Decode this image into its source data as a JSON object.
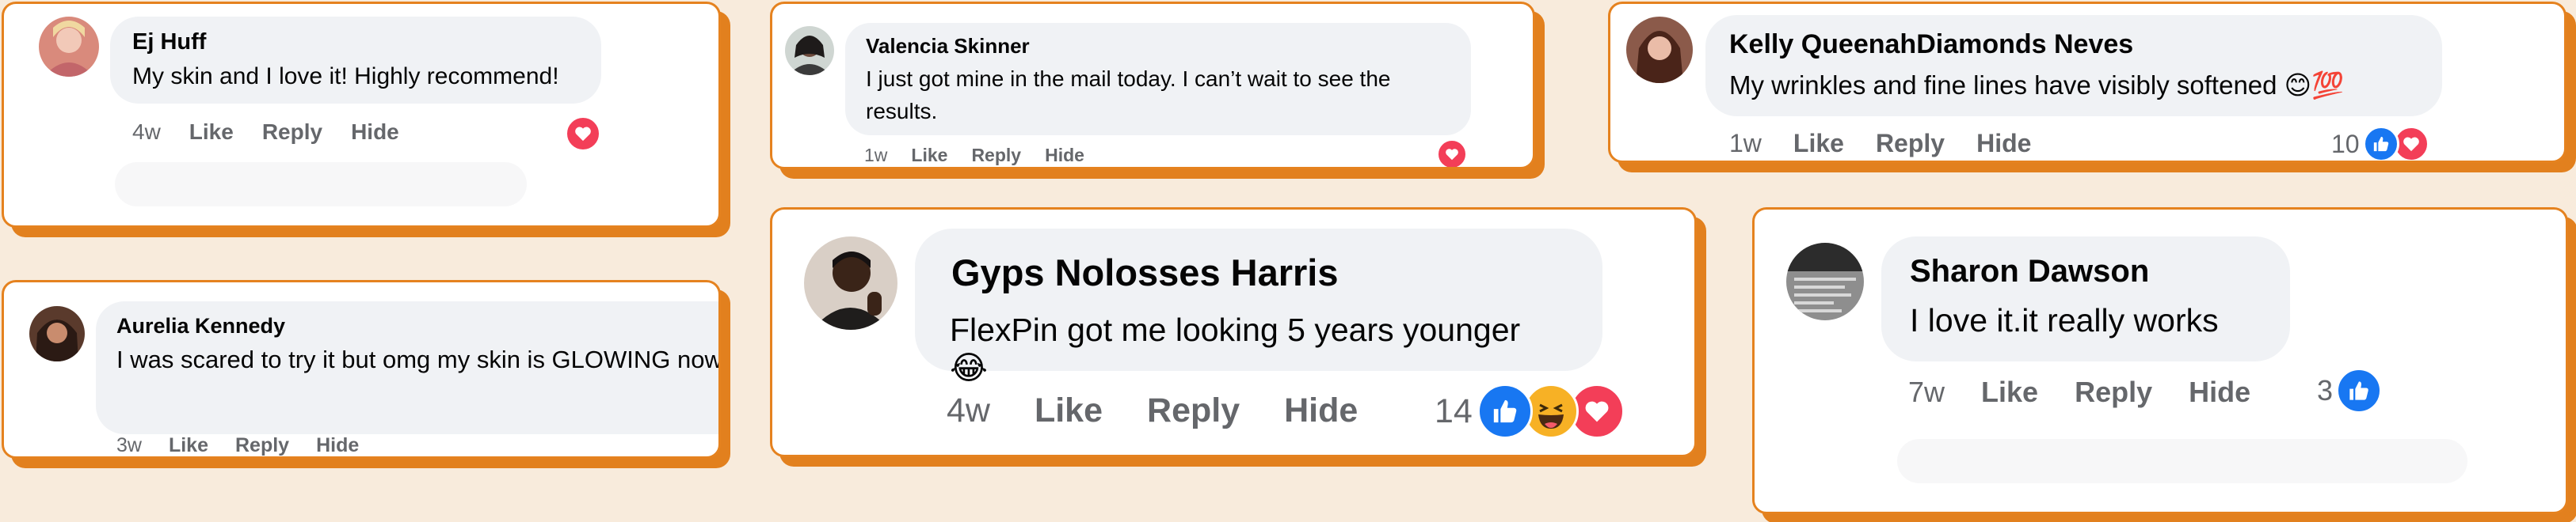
{
  "comments": [
    {
      "name": "Ej Huff",
      "text": "My skin and I love it! Highly recommend!",
      "time": "4w",
      "like": "Like",
      "reply": "Reply",
      "hide": "Hide",
      "reactions": [
        "heart-icon"
      ]
    },
    {
      "name": "Valencia Skinner",
      "text": "I just got mine in the mail today. I can’t wait to see the results.",
      "time": "1w",
      "like": "Like",
      "reply": "Reply",
      "hide": "Hide",
      "reactions": [
        "heart-icon"
      ]
    },
    {
      "name": "Kelly QueenahDiamonds Neves",
      "text": "My wrinkles and fine lines have visibly softened 😊💯",
      "time": "1w",
      "like": "Like",
      "reply": "Reply",
      "hide": "Hide",
      "reaction_count": "10",
      "reactions": [
        "like-icon",
        "heart-icon"
      ]
    },
    {
      "name": "Aurelia Kennedy",
      "text": "I was scared to try it but omg my skin is GLOWING now",
      "time": "3w",
      "like": "Like",
      "reply": "Reply",
      "hide": "Hide"
    },
    {
      "name": "Gyps Nolosses Harris",
      "text": "FlexPin got me looking 5 years younger 😂",
      "time": "4w",
      "like": "Like",
      "reply": "Reply",
      "hide": "Hide",
      "reaction_count": "14",
      "reactions": [
        "like-icon",
        "haha-icon",
        "heart-icon"
      ]
    },
    {
      "name": "Sharon Dawson",
      "text": "I love it.it really works",
      "time": "7w",
      "like": "Like",
      "reply": "Reply",
      "hide": "Hide",
      "reaction_count": "3",
      "reactions": [
        "like-icon"
      ]
    }
  ],
  "colors": {
    "background": "#f8ebdc",
    "card_border": "#e5821f",
    "bubble": "#f0f2f5",
    "like_blue": "#1877f2",
    "heart_red": "#f33e58",
    "haha_yellow": "#f7b125",
    "meta_gray": "#65676b"
  }
}
